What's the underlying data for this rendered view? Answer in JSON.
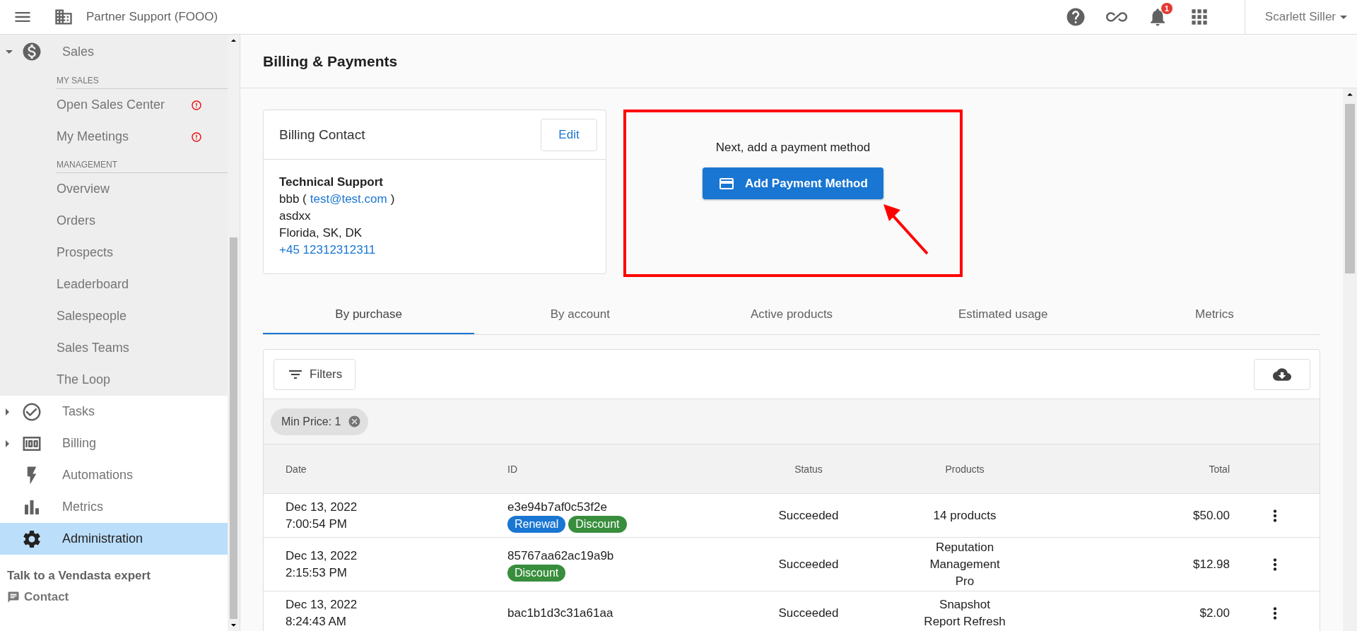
{
  "topbar": {
    "org_name": "Partner Support (FOOO)",
    "notification_count": "1",
    "user_name": "Scarlett Siller"
  },
  "sidebar": {
    "nav": [
      {
        "label": "Sales",
        "expanded": true,
        "selected": false,
        "sections": [
          {
            "heading": "MY SALES",
            "items": [
              {
                "label": "Open Sales Center",
                "alert": true
              },
              {
                "label": "My Meetings",
                "alert": true
              }
            ]
          },
          {
            "heading": "MANAGEMENT",
            "items": [
              {
                "label": "Overview",
                "alert": false
              },
              {
                "label": "Orders",
                "alert": false
              },
              {
                "label": "Prospects",
                "alert": false
              },
              {
                "label": "Leaderboard",
                "alert": false
              },
              {
                "label": "Salespeople",
                "alert": false
              },
              {
                "label": "Sales Teams",
                "alert": false
              },
              {
                "label": "The Loop",
                "alert": false
              }
            ]
          }
        ]
      },
      {
        "label": "Tasks",
        "expanded": false,
        "selected": false
      },
      {
        "label": "Billing",
        "expanded": false,
        "selected": false
      },
      {
        "label": "Automations",
        "selected": false
      },
      {
        "label": "Metrics",
        "selected": false
      },
      {
        "label": "Administration",
        "selected": true
      }
    ],
    "footer": {
      "title": "Talk to a Vendasta expert",
      "contact": "Contact"
    }
  },
  "page": {
    "title": "Billing & Payments",
    "billing_contact": {
      "title": "Billing Contact",
      "edit": "Edit",
      "name": "Technical Support",
      "contact_prefix": "bbb (",
      "email": "test@test.com",
      "contact_suffix": ")",
      "address_line": "asdxx",
      "region": "Florida, SK, DK",
      "phone": "+45 12312312311"
    },
    "payment_prompt": {
      "text": "Next, add a payment method",
      "button": "Add Payment Method"
    },
    "tabs": [
      {
        "label": "By purchase",
        "selected": true
      },
      {
        "label": "By account",
        "selected": false
      },
      {
        "label": "Active products",
        "selected": false
      },
      {
        "label": "Estimated usage",
        "selected": false
      },
      {
        "label": "Metrics",
        "selected": false
      }
    ],
    "table": {
      "filters_button": "Filters",
      "filter_chips": [
        "Min Price: 1"
      ],
      "columns": [
        "Date",
        "ID",
        "Status",
        "Products",
        "Total"
      ],
      "rows": [
        {
          "date": "Dec 13, 2022",
          "time": "7:00:54 PM",
          "id": "e3e94b7af0c53f2e",
          "tags": [
            {
              "label": "Renewal",
              "color": "#1976d2"
            },
            {
              "label": "Discount",
              "color": "#388e3c"
            }
          ],
          "status": "Succeeded",
          "products": "14 products",
          "total": "$50.00"
        },
        {
          "date": "Dec 13, 2022",
          "time": "2:15:53 PM",
          "id": "85767aa62ac19a9b",
          "tags": [
            {
              "label": "Discount",
              "color": "#388e3c"
            }
          ],
          "status": "Succeeded",
          "products": "Reputation\nManagement\nPro",
          "total": "$12.98"
        },
        {
          "date": "Dec 13, 2022",
          "time": "8:24:43 AM",
          "id": "bac1b1d3c31a61aa",
          "tags": [],
          "status": "Succeeded",
          "products": "Snapshot\nReport Refresh",
          "total": "$2.00"
        }
      ]
    }
  }
}
